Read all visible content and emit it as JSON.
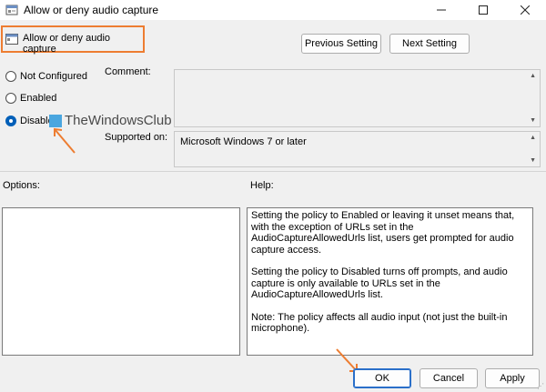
{
  "window": {
    "title": "Allow or deny audio capture",
    "controls": {
      "minimize": "—",
      "maximize": "☐",
      "close": "✕"
    }
  },
  "header": {
    "policy_name": "Allow or deny audio capture",
    "prev_label": "Previous Setting",
    "next_label": "Next Setting"
  },
  "state": {
    "options": [
      {
        "label": "Not Configured",
        "checked": false
      },
      {
        "label": "Enabled",
        "checked": false
      },
      {
        "label": "Disabled",
        "checked": true
      }
    ]
  },
  "comment": {
    "label": "Comment:",
    "value": ""
  },
  "supported": {
    "label": "Supported on:",
    "value": "Microsoft Windows 7 or later"
  },
  "options_section": {
    "label": "Options:"
  },
  "help_section": {
    "label": "Help:",
    "paragraphs": [
      "Setting the policy to Enabled or leaving it unset means that, with the exception of URLs set in the AudioCaptureAllowedUrls list, users get prompted for audio capture access.",
      "Setting the policy to Disabled turns off prompts, and audio capture is only available to URLs set in the AudioCaptureAllowedUrls list.",
      "Note: The policy affects all audio input (not just the built-in microphone)."
    ]
  },
  "watermark": {
    "text": "TheWindowsClub"
  },
  "footer": {
    "ok_label": "OK",
    "cancel_label": "Cancel",
    "apply_label": "Apply"
  },
  "colors": {
    "highlight": "#ed7d31",
    "radio_checked": "#005fb8",
    "ok_border": "#2a6fc9"
  },
  "icons": [
    "policy-icon",
    "arrow-annotation-icon",
    "scroll-up-icon",
    "scroll-down-icon"
  ]
}
